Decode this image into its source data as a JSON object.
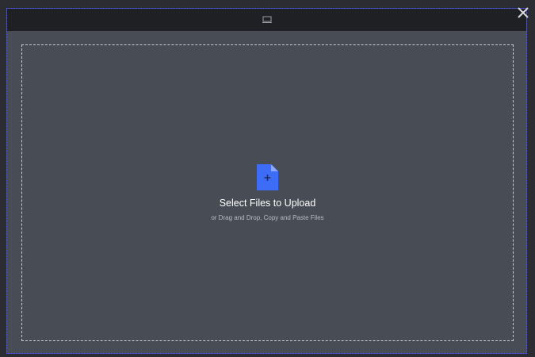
{
  "modal": {
    "header": {
      "icon": "device-icon"
    },
    "dropzone": {
      "icon": "file-add-icon",
      "title": "Select Files to Upload",
      "subtitle": "or Drag and Drop, Copy and Paste Files"
    }
  },
  "close": {
    "icon": "close-icon"
  },
  "colors": {
    "modal_bg": "#474c55",
    "header_bg": "#1f2023",
    "accent": "#3d6cf7",
    "border": "#c8cbd2"
  }
}
